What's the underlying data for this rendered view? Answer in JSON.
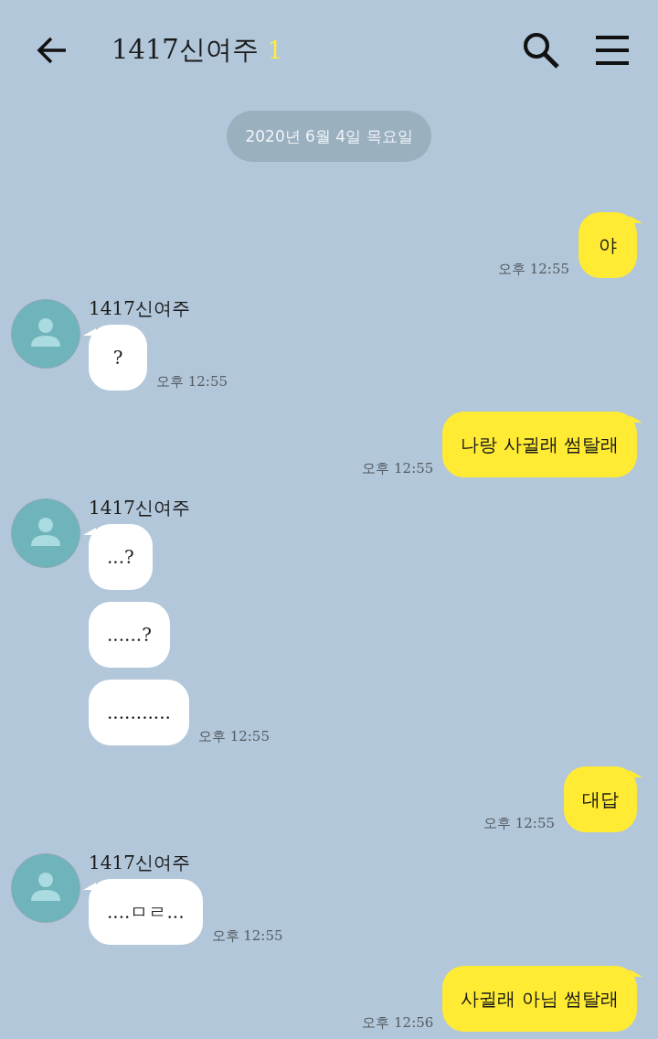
{
  "header": {
    "title": "1417신여주",
    "unread_count": "1"
  },
  "date_divider": "2020년 6월 4일 목요일",
  "messages": [
    {
      "kind": "sent",
      "bubbles": [
        "야"
      ],
      "time": "오후 12:55"
    },
    {
      "kind": "received",
      "sender": "1417신여주",
      "bubbles": [
        "?"
      ],
      "time": "오후 12:55"
    },
    {
      "kind": "sent",
      "bubbles": [
        "나랑 사귈래 썸탈래"
      ],
      "time": "오후 12:55"
    },
    {
      "kind": "received",
      "sender": "1417신여주",
      "bubbles": [
        "...?",
        "......?",
        "..........."
      ],
      "time": "오후 12:55"
    },
    {
      "kind": "sent",
      "bubbles": [
        "대답"
      ],
      "time": "오후 12:55"
    },
    {
      "kind": "received",
      "sender": "1417신여주",
      "bubbles": [
        "....ㅁㄹ..."
      ],
      "time": "오후 12:55"
    },
    {
      "kind": "sent",
      "bubbles": [
        "사귈래 아님 썸탈래"
      ],
      "time": "오후 12:56"
    }
  ]
}
